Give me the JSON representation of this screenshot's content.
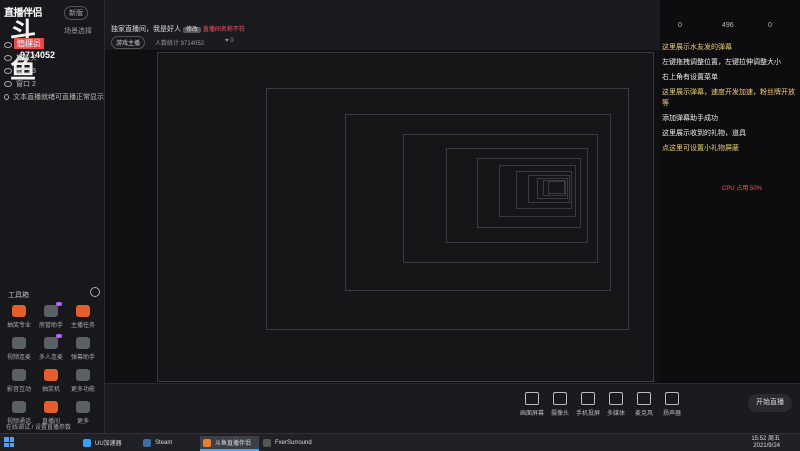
{
  "app": {
    "logo_title": "直播伴侣",
    "logo_big": "斗鱼",
    "logo_tag": "管理员",
    "room_id": "9714052",
    "version_badge": "新版",
    "scene_header": "场景选择"
  },
  "scenes": [
    {
      "label": "场景一"
    },
    {
      "label": "摄像头"
    },
    {
      "label": "窗口 3"
    },
    {
      "label": "窗口 2"
    },
    {
      "label": "文本直播就绪可直播正常显示"
    }
  ],
  "tools": {
    "header": "工具箱",
    "items": [
      {
        "label": "抽奖专业",
        "icon": "gift-icon",
        "accent": true
      },
      {
        "label": "房管助手",
        "icon": "people-icon",
        "accent": false
      },
      {
        "label": "主播任务",
        "icon": "flag-icon",
        "accent": true
      },
      {
        "label": "视频连麦",
        "icon": "video-icon",
        "accent": false
      },
      {
        "label": "多人连麦",
        "icon": "mic-icon",
        "accent": false
      },
      {
        "label": "弹幕助手",
        "icon": "chat-icon",
        "accent": false
      },
      {
        "label": "影音互动",
        "icon": "play-icon",
        "accent": false
      },
      {
        "label": "抽奖机",
        "icon": "box-icon",
        "accent": true
      },
      {
        "label": "更多功能",
        "icon": "grid-icon",
        "accent": false
      },
      {
        "label": "视频通话",
        "icon": "phone-icon",
        "accent": false
      },
      {
        "label": "直播间",
        "icon": "home-icon",
        "accent": true
      },
      {
        "label": "更多",
        "icon": "more-icon",
        "accent": false
      }
    ]
  },
  "top": {
    "title": "独家直播间，我是好人",
    "edit_label": "修改",
    "warning": "直播间名称不符",
    "chip": "游戏主播",
    "viewers": "人数统计 9714052",
    "likes": "0"
  },
  "right_panel": {
    "stats": [
      "0",
      "496",
      "0"
    ],
    "messages": [
      {
        "text": "这里展示水友发的弹幕",
        "sys": true
      },
      {
        "text": "左键拖拽调整位置，左键拉伸调整大小",
        "sys": false
      },
      {
        "text": "右上角有设置菜单",
        "sys": false
      },
      {
        "text": "这里展示弹幕，速度开发加速，粉丝牌开放等",
        "sys": true
      },
      {
        "text": "添加弹幕助手成功",
        "sys": false
      },
      {
        "text": "这里展示收到的礼物，道具",
        "sys": false
      },
      {
        "text": "点这里可设置小礼物屏蔽",
        "sys": true
      }
    ],
    "cpu": "CPU 占用 50%"
  },
  "toolbar": {
    "buttons": [
      {
        "label": "画面屏幕",
        "icon": "screen-icon"
      },
      {
        "label": "摄像头",
        "icon": "camera-icon"
      },
      {
        "label": "手机投屏",
        "icon": "phone-cast-icon"
      },
      {
        "label": "多媒体",
        "icon": "media-icon"
      },
      {
        "label": "麦克风",
        "icon": "mic-icon"
      },
      {
        "label": "扬声器",
        "icon": "speaker-icon"
      }
    ],
    "go_label": "开始直播"
  },
  "taskbar": {
    "apps": [
      {
        "label": "UU加速器",
        "color": "#3aa0ff",
        "active": false
      },
      {
        "label": "Steam",
        "color": "#3a6ea5",
        "active": false
      },
      {
        "label": "斗鱼直播伴侣",
        "color": "#f57a24",
        "active": true
      },
      {
        "label": "FxerSurround",
        "color": "#555",
        "active": false
      }
    ],
    "time": "15:52 周五",
    "date": "2021/9/24",
    "notify": "在线调试 / 设置直播参数"
  },
  "colors": {
    "accent": "#e85c2a",
    "badge": "#b565f6",
    "warn": "#ff5555"
  }
}
